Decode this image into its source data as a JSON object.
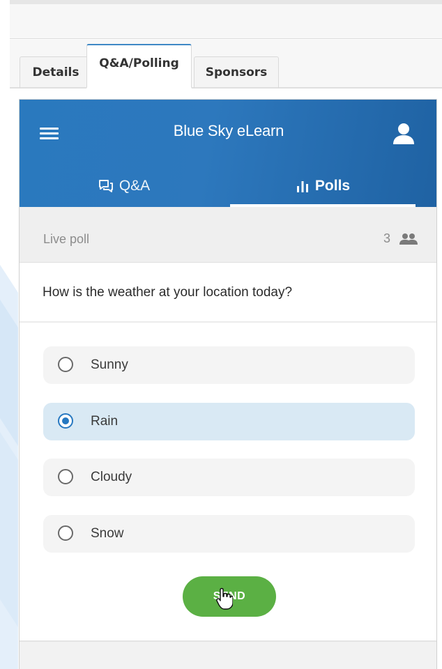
{
  "outer_tabs": [
    {
      "label": "Details"
    },
    {
      "label": "Q&A/Polling"
    },
    {
      "label": "Sponsors"
    }
  ],
  "app": {
    "title": "Blue Sky eLearn",
    "subtabs": [
      {
        "label": "Q&A",
        "icon": "chat-bubbles-icon"
      },
      {
        "label": "Polls",
        "icon": "bar-chart-icon"
      }
    ]
  },
  "poll": {
    "status_label": "Live poll",
    "participant_count": "3",
    "question": "How is the weather at your location today?",
    "options": [
      {
        "label": "Sunny",
        "selected": false
      },
      {
        "label": "Rain",
        "selected": true
      },
      {
        "label": "Cloudy",
        "selected": false
      },
      {
        "label": "Snow",
        "selected": false
      }
    ],
    "send_label": "SEND"
  },
  "colors": {
    "header_blue": "#2a79be",
    "selected_option": "#d9e9f4",
    "radio_accent": "#2678c1",
    "send_green": "#5bb044"
  }
}
